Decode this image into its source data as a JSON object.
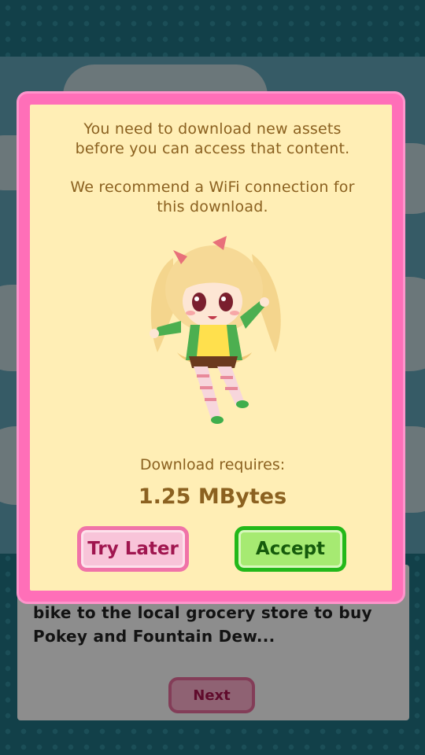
{
  "dialog": {
    "message_line1": "You need to download new assets",
    "message_line2": "before you can access that content.",
    "wifi_line1": "We recommend a WiFi connection for",
    "wifi_line2": "this download.",
    "requires_label": "Download requires:",
    "size": "1.25 MBytes",
    "try_later_label": "Try Later",
    "accept_label": "Accept",
    "character_icon": "chibi-girl-illustration"
  },
  "story": {
    "line1": "bike to the local grocery store to buy",
    "line2": "Pokey and Fountain Dew...",
    "next_label": "Next"
  },
  "colors": {
    "frame_pink": "#ff6fb8",
    "panel_cream": "#ffeeb5",
    "text_brown": "#8b6120",
    "accept_green": "#23b81a",
    "later_pink": "#f073a8",
    "background_teal": "#1f6f7e"
  }
}
